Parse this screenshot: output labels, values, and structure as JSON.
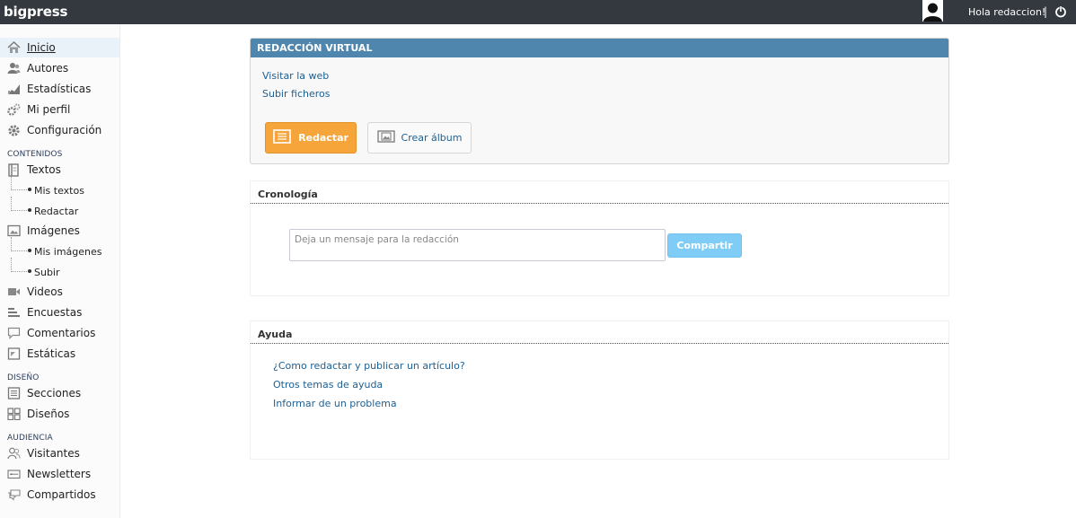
{
  "topbar": {
    "brand": "bigpress",
    "greeting": "Hola redaccion!",
    "separator": "|"
  },
  "sidebar": {
    "items": [
      {
        "label": "Inicio",
        "icon": "home-icon"
      },
      {
        "label": "Autores",
        "icon": "users-icon"
      },
      {
        "label": "Estadísticas",
        "icon": "stats-icon"
      },
      {
        "label": "Mi perfil",
        "icon": "profile-gears-icon"
      },
      {
        "label": "Configuración",
        "icon": "gear-icon"
      }
    ],
    "contenidos_label": "CONTENIDOS",
    "textos": {
      "label": "Textos",
      "icon": "book-icon",
      "sub": [
        "Mis textos",
        "Redactar"
      ]
    },
    "imagenes": {
      "label": "Imágenes",
      "icon": "image-icon",
      "sub": [
        "Mis imágenes",
        "Subir"
      ]
    },
    "more": [
      {
        "label": "Videos",
        "icon": "video-icon"
      },
      {
        "label": "Encuestas",
        "icon": "poll-icon"
      },
      {
        "label": "Comentarios",
        "icon": "comment-icon"
      },
      {
        "label": "Estáticas",
        "icon": "static-page-icon"
      }
    ],
    "diseno_label": "DISEÑO",
    "diseno": [
      {
        "label": "Secciones",
        "icon": "sections-icon"
      },
      {
        "label": "Diseños",
        "icon": "layouts-icon"
      }
    ],
    "audiencia_label": "AUDIENCIA",
    "audiencia": [
      {
        "label": "Visitantes",
        "icon": "visitors-icon"
      },
      {
        "label": "Newsletters",
        "icon": "newsletter-icon"
      },
      {
        "label": "Compartidos",
        "icon": "shared-icon"
      }
    ]
  },
  "redaccion": {
    "title": "REDACCIÓN VIRTUAL",
    "link_web": "Visitar la web",
    "link_upload": "Subir ficheros",
    "btn_write": "Redactar",
    "btn_album": "Crear álbum"
  },
  "cronologia": {
    "title": "Cronología",
    "placeholder": "Deja un mensaje para la redacción",
    "btn_share": "Compartir"
  },
  "ayuda": {
    "title": "Ayuda",
    "links": [
      "¿Como redactar y publicar un artículo?",
      "Otros temas de ayuda",
      "Informar de un problema"
    ]
  },
  "colors": {
    "topbar": "#34393f",
    "panel_header": "#4f86ad",
    "primary_button": "#f6a53b",
    "share_button": "#7fcdf6",
    "link": "#1c5f93"
  }
}
